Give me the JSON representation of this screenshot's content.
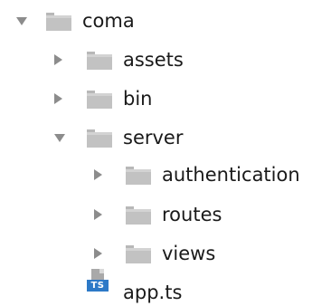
{
  "tree": {
    "root": {
      "label": "coma",
      "expanded": true
    },
    "items": [
      {
        "label": "assets",
        "expanded": false
      },
      {
        "label": "bin",
        "expanded": false
      },
      {
        "label": "server",
        "expanded": true
      },
      {
        "label": "authentication",
        "expanded": false
      },
      {
        "label": "routes",
        "expanded": false
      },
      {
        "label": "views",
        "expanded": false
      }
    ],
    "file": {
      "label": "app.ts",
      "badge": "TS"
    }
  },
  "colors": {
    "folder": "#c2c2c2",
    "arrow": "#8c8c8c",
    "ts_badge": "#2d79c7",
    "text": "#1a1a1a"
  }
}
